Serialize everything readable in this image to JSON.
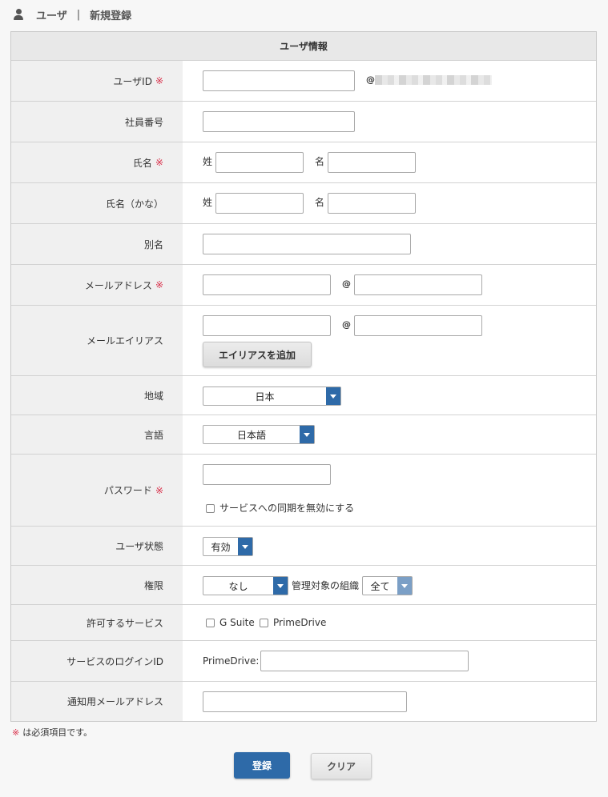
{
  "breadcrumb": {
    "section": "ユーザ",
    "separator": "|",
    "page": "新規登録"
  },
  "form": {
    "title": "ユーザ情報",
    "required_mark": "※",
    "user_id": {
      "label": "ユーザID",
      "value": "",
      "at": "@"
    },
    "employee_no": {
      "label": "社員番号",
      "value": ""
    },
    "name": {
      "label": "氏名",
      "last_label": "姓",
      "first_label": "名",
      "last": "",
      "first": ""
    },
    "name_kana": {
      "label": "氏名（かな）",
      "last_label": "姓",
      "first_label": "名",
      "last": "",
      "first": ""
    },
    "alias_name": {
      "label": "別名",
      "value": ""
    },
    "email": {
      "label": "メールアドレス",
      "local": "",
      "at": "@",
      "domain": ""
    },
    "email_alias": {
      "label": "メールエイリアス",
      "local": "",
      "at": "@",
      "domain": "",
      "add_button": "エイリアスを追加"
    },
    "region": {
      "label": "地域",
      "selected": "日本"
    },
    "language": {
      "label": "言語",
      "selected": "日本語"
    },
    "password": {
      "label": "パスワード",
      "value": "",
      "disable_sync_label": "サービスへの同期を無効にする",
      "disable_sync_checked": false
    },
    "status": {
      "label": "ユーザ状態",
      "selected": "有効"
    },
    "permission": {
      "label": "権限",
      "selected": "なし",
      "org_label": "管理対象の組織",
      "org_selected": "全て"
    },
    "services": {
      "label": "許可するサービス",
      "options": [
        {
          "label": "G Suite",
          "checked": false
        },
        {
          "label": "PrimeDrive",
          "checked": false
        }
      ]
    },
    "service_login": {
      "label": "サービスのログインID",
      "prefix": "PrimeDrive:",
      "value": ""
    },
    "notify_email": {
      "label": "通知用メールアドレス",
      "value": ""
    }
  },
  "footer_note": {
    "mark": "※",
    "text": "は必須項目です。"
  },
  "actions": {
    "submit": "登録",
    "clear": "クリア"
  },
  "colors": {
    "accent": "#2e6aa8",
    "required": "#d9304a"
  }
}
